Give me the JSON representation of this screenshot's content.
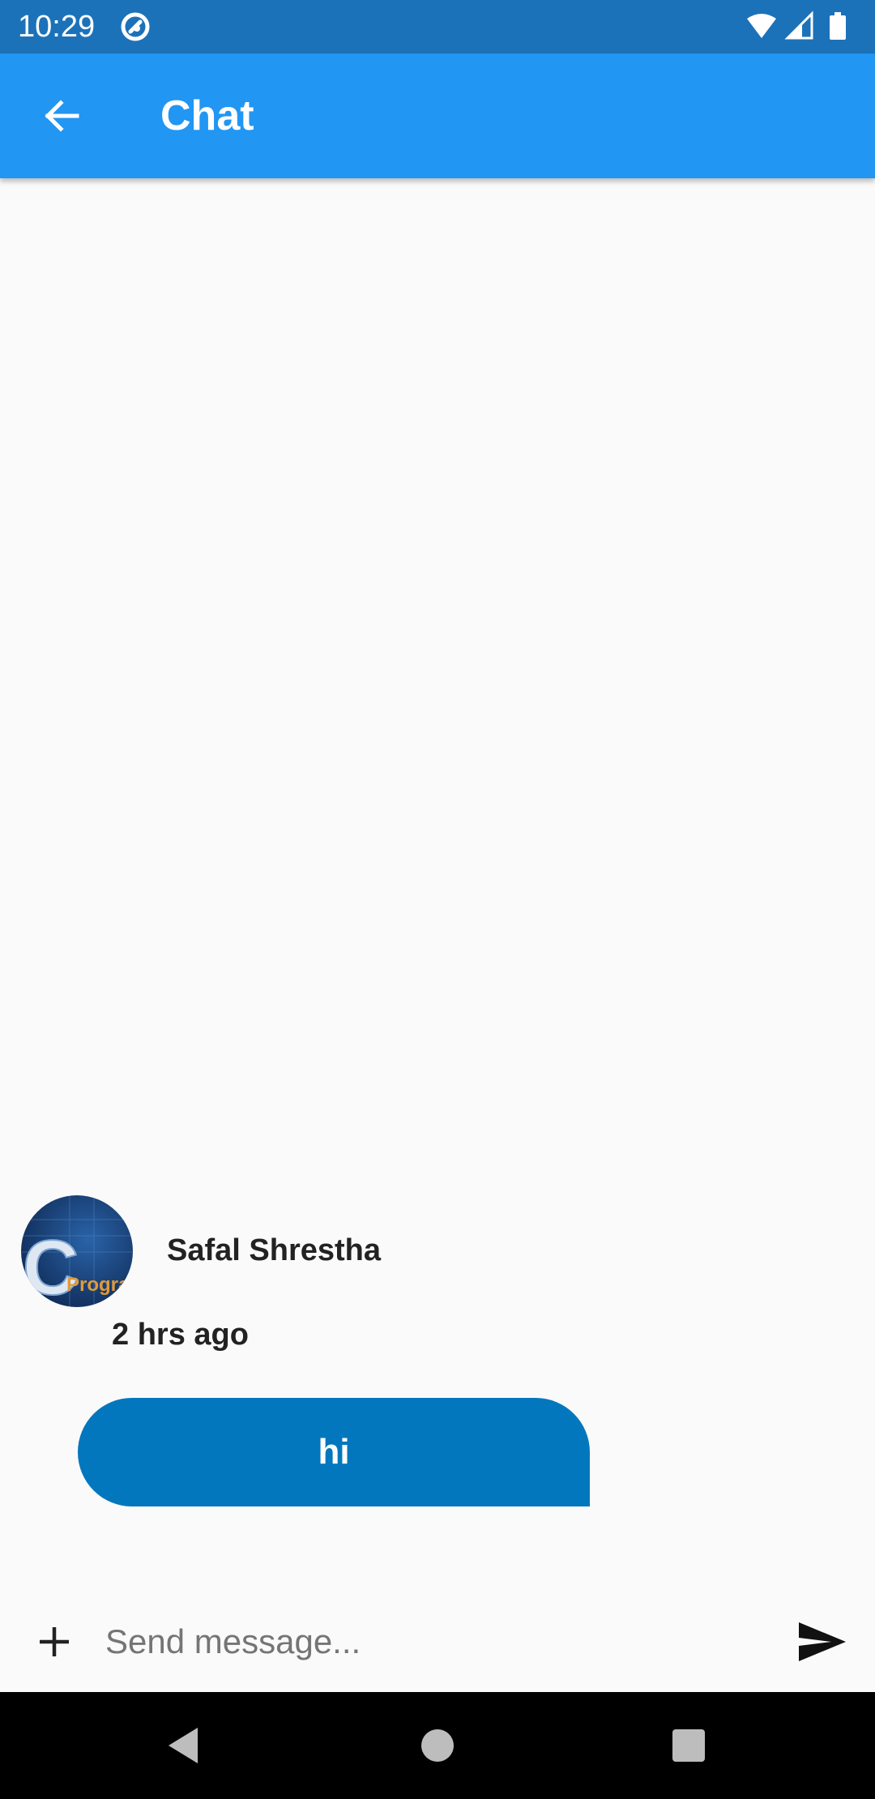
{
  "status_bar": {
    "time": "10:29",
    "icons": [
      "app-notification-icon",
      "wifi-icon",
      "signal-icon",
      "battery-icon"
    ]
  },
  "app_bar": {
    "title": "Chat",
    "back_icon": "arrow-left-icon",
    "color": "#2196f3"
  },
  "message": {
    "sender_name": "Safal Shrestha",
    "time": "2 hrs ago",
    "text": "hi",
    "avatar_letter": "C",
    "avatar_caption": "Progra",
    "bubble_color": "#0277bd"
  },
  "composer": {
    "placeholder": "Send message...",
    "value": "",
    "add_icon": "plus-icon",
    "send_icon": "send-icon"
  },
  "nav_bar": {
    "icons": [
      "back-triangle-icon",
      "home-circle-icon",
      "recents-square-icon"
    ]
  }
}
